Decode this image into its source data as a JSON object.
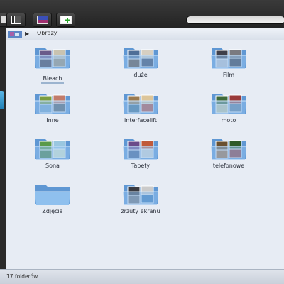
{
  "toolbar": {
    "buttons": [
      {
        "icon": "window-icon"
      },
      {
        "icon": "columns-view-icon"
      },
      {
        "icon": "desktop-preview-icon"
      },
      {
        "icon": "new-folder-icon"
      }
    ],
    "search": {
      "placeholder": ""
    }
  },
  "path": {
    "icon": "pictures-folder-icon",
    "separator": "▶",
    "current": "Obrazy"
  },
  "folders": [
    {
      "name": "Bleach",
      "preview": "images",
      "selected": true
    },
    {
      "name": "duże",
      "preview": "images"
    },
    {
      "name": "Film",
      "preview": "images"
    },
    {
      "name": "Inne",
      "preview": "images"
    },
    {
      "name": "interfacelift",
      "preview": "images"
    },
    {
      "name": "moto",
      "preview": "images"
    },
    {
      "name": "Sona",
      "preview": "images"
    },
    {
      "name": "Tapety",
      "preview": "images"
    },
    {
      "name": "telefonowe",
      "preview": "images"
    },
    {
      "name": "Zdjęcia",
      "preview": "empty"
    },
    {
      "name": "zrzuty ekranu",
      "preview": "images"
    }
  ],
  "status": {
    "text": "17 folderów"
  },
  "colors": {
    "content_bg": "#e7ecf4",
    "folder_blue": "#7fb2e6",
    "accent": "#2f8fd0"
  }
}
